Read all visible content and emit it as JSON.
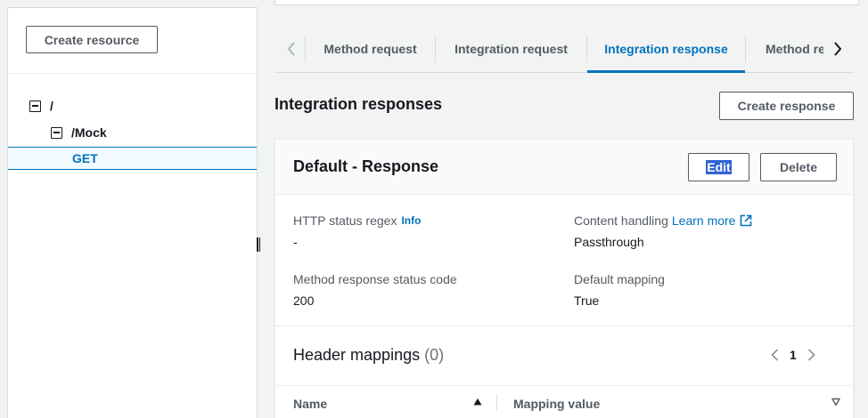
{
  "sidebar": {
    "create_resource_label": "Create resource",
    "tree": [
      {
        "label": "/",
        "level": 0,
        "collapsible": true
      },
      {
        "label": "/Mock",
        "level": 1,
        "collapsible": true
      },
      {
        "label": "GET",
        "level": 2,
        "selected": true
      }
    ]
  },
  "tabs": [
    {
      "label": "Method request"
    },
    {
      "label": "Integration request"
    },
    {
      "label": "Integration response",
      "active": true
    },
    {
      "label": "Method re"
    }
  ],
  "section": {
    "title": "Integration responses",
    "create_response_label": "Create response"
  },
  "card": {
    "title": "Default - Response",
    "edit_label": "Edit",
    "delete_label": "Delete",
    "fields": {
      "status_regex": {
        "label": "HTTP status regex",
        "info": "Info",
        "value": "-"
      },
      "content_handling": {
        "label": "Content handling",
        "link": "Learn more",
        "value": "Passthrough"
      },
      "method_status": {
        "label": "Method response status code",
        "value": "200"
      },
      "default_mapping": {
        "label": "Default mapping",
        "value": "True"
      }
    },
    "header_mappings": {
      "title": "Header mappings",
      "count": "(0)",
      "page": "1",
      "columns": [
        "Name",
        "Mapping value"
      ]
    }
  },
  "colors": {
    "accent": "#0073bb",
    "text": "#16191f",
    "secondary_text": "#545b64",
    "background": "#f2f3f3",
    "selection_highlight": "#3162d4"
  }
}
